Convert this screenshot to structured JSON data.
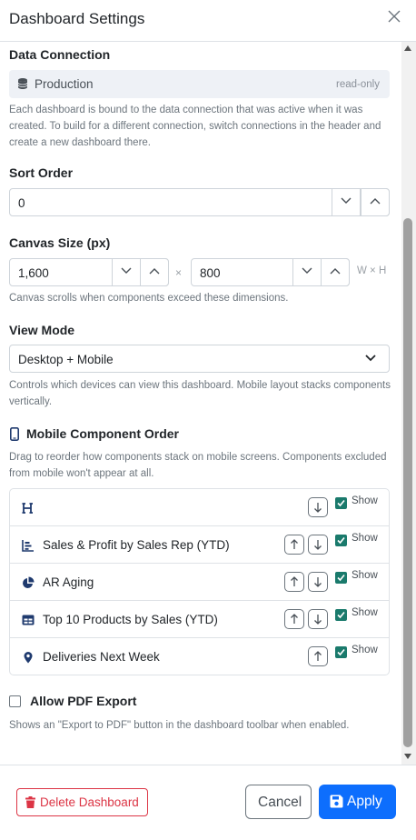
{
  "dialog": {
    "title": "Dashboard Settings"
  },
  "data_connection": {
    "label": "Data Connection",
    "value": "Production",
    "badge": "read-only",
    "help": "Each dashboard is bound to the data connection that was active when it was created. To build for a different connection, switch connections in the header and create a new dashboard there."
  },
  "sort_order": {
    "label": "Sort Order",
    "value": "0"
  },
  "canvas_size": {
    "label": "Canvas Size (px)",
    "width": "1,600",
    "height": "800",
    "times": "×",
    "wh": "W × H",
    "help": "Canvas scrolls when components exceed these dimensions."
  },
  "view_mode": {
    "label": "View Mode",
    "value": "Desktop + Mobile",
    "help": "Controls which devices can view this dashboard. Mobile layout stacks components vertically."
  },
  "mobile_order": {
    "label": "Mobile Component Order",
    "help": "Drag to reorder how components stack on mobile screens. Components excluded from mobile won't appear at all.",
    "show_label": "Show",
    "items": [
      {
        "name": "",
        "icon": "heading-icon",
        "show": true
      },
      {
        "name": "Sales & Profit by Sales Rep (YTD)",
        "icon": "bar-chart-icon",
        "show": true
      },
      {
        "name": "AR Aging",
        "icon": "pie-chart-icon",
        "show": true
      },
      {
        "name": "Top 10 Products by Sales (YTD)",
        "icon": "table-icon",
        "show": true
      },
      {
        "name": "Deliveries Next Week",
        "icon": "map-pin-icon",
        "show": true
      }
    ]
  },
  "pdf_export": {
    "label": "Allow PDF Export",
    "checked": false,
    "help": "Shows an \"Export to PDF\" button in the dashboard toolbar when enabled."
  },
  "footer": {
    "delete_label": "Delete Dashboard",
    "cancel_label": "Cancel",
    "apply_label": "Apply"
  },
  "colors": {
    "primary": "#0d6efd",
    "danger": "#dc3545",
    "checkbox": "#1a7a6c",
    "icon": "#1f3a6e"
  }
}
